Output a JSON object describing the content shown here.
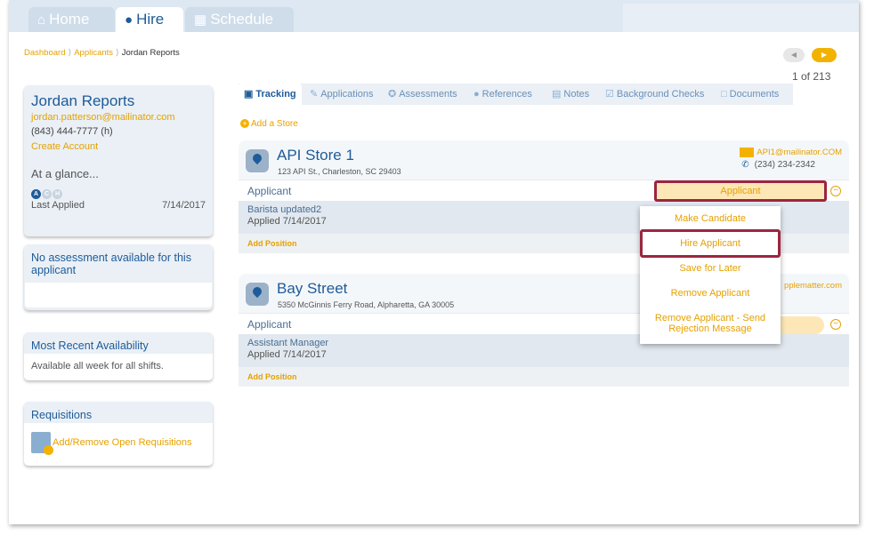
{
  "nav": {
    "tabs": [
      {
        "label": "Home",
        "icon": "home-icon"
      },
      {
        "label": "Hire",
        "icon": "user-icon"
      },
      {
        "label": "Schedule",
        "icon": "calendar-icon"
      }
    ]
  },
  "breadcrumb": {
    "items": [
      "Dashboard",
      "Applicants"
    ],
    "current": "Jordan Reports"
  },
  "pager": {
    "count": "1 of 213"
  },
  "profile": {
    "name": "Jordan Reports",
    "email": "jordan.patterson@mailinator.com",
    "phone": "(843) 444-7777 (h)",
    "create_account": "Create Account",
    "glance": "At a glance...",
    "badges": [
      "A",
      "C",
      "H"
    ],
    "last_applied_label": "Last Applied",
    "last_applied_date": "7/14/2017"
  },
  "assessment": {
    "text": "No assessment available for this applicant"
  },
  "availability": {
    "title": "Most Recent Availability",
    "text": "Available all week for all shifts."
  },
  "requisitions": {
    "title": "Requisitions",
    "link": "Add/Remove Open Requisitions"
  },
  "tabs": [
    "Tracking",
    "Applications",
    "Assessments",
    "References",
    "Notes",
    "Background Checks",
    "Documents"
  ],
  "add_store": "Add a Store",
  "stores": [
    {
      "name": "API Store 1",
      "address": "123 API St., Charleston, SC 29403",
      "email": "API1@mailinator.COM",
      "phone": "(234) 234-2342",
      "row_label": "Applicant",
      "status": "Applicant",
      "position": "Barista updated2",
      "applied": "Applied 7/14/2017",
      "add_position": "Add Position"
    },
    {
      "name": "Bay Street",
      "address": "5350 McGinnis Ferry Road, Alpharetta, GA 30005",
      "email": "pplematter.com",
      "row_label": "Applicant",
      "position": "Assistant Manager",
      "applied": "Applied 7/14/2017",
      "add_position": "Add Position"
    }
  ],
  "dropdown": {
    "items": [
      "Make Candidate",
      "Hire Applicant",
      "Save for Later",
      "Remove Applicant",
      "Remove Applicant - Send Rejection Message"
    ]
  },
  "colors": {
    "brand": "#1e5b99",
    "accent": "#e6a100",
    "highlight": "#9c2540"
  }
}
